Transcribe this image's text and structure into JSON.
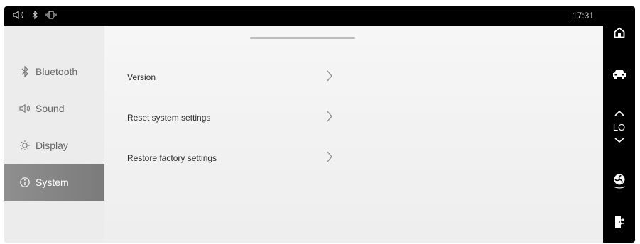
{
  "status_bar": {
    "time": "17:31",
    "icons": [
      "volume-icon",
      "bluetooth-icon",
      "phone-vibrate-icon"
    ]
  },
  "sidebar": {
    "items": [
      {
        "label": "Bluetooth",
        "icon": "bluetooth-icon",
        "active": false
      },
      {
        "label": "Sound",
        "icon": "speaker-icon",
        "active": false
      },
      {
        "label": "Display",
        "icon": "brightness-icon",
        "active": false
      },
      {
        "label": "System",
        "icon": "info-icon",
        "active": true
      }
    ]
  },
  "system_panel": {
    "rows": [
      {
        "label": "Version"
      },
      {
        "label": "Reset system settings"
      },
      {
        "label": "Restore factory settings"
      }
    ]
  },
  "right_rail": {
    "buttons": [
      "home-icon",
      "car-icon",
      "chevron-up-icon",
      "chevron-down-icon",
      "fan-icon",
      "door-exit-icon"
    ],
    "temperature_label": "LO"
  },
  "colors": {
    "active_item_bg": "#7f7f7f",
    "panel_bg": "#f3f3f3",
    "rail_bg": "#000000"
  }
}
